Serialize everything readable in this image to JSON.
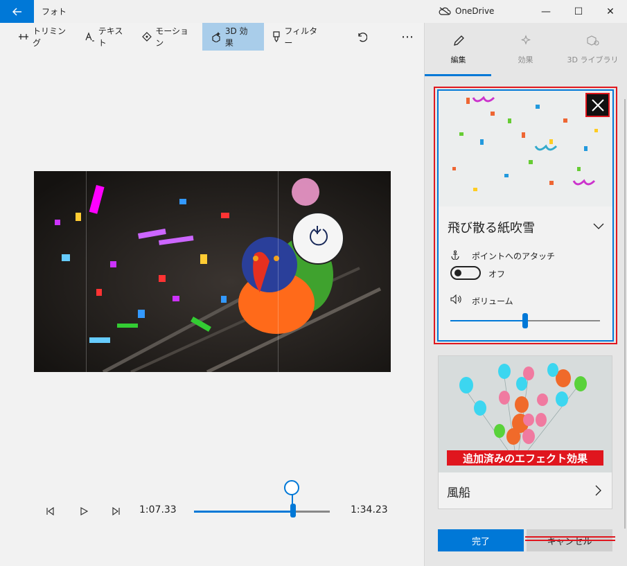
{
  "window": {
    "app_title": "フォト",
    "onedrive_label": "OneDrive",
    "minimize_glyph": "—",
    "maximize_glyph": "☐",
    "close_glyph": "✕"
  },
  "toolbar": {
    "trim_label": "トリミング",
    "text_label": "テキスト",
    "motion_label": "モーション",
    "effects3d_label": "3D 効果",
    "filter_label": "フィルター",
    "more_glyph": "⋯"
  },
  "playback": {
    "current_time": "1:07.33",
    "total_time": "1:34.23",
    "progress_fraction": 0.73
  },
  "tabs": {
    "edit": "編集",
    "effects": "効果",
    "library": "3D ライブラリ"
  },
  "effect_card": {
    "title": "飛び散る紙吹雪",
    "attach_label": "ポイントへのアタッチ",
    "toggle_state": "オフ",
    "volume_label": "ボリューム",
    "volume_fraction": 0.5
  },
  "balloon_card": {
    "added_label": "追加済みのエフェクト効果",
    "name": "風船"
  },
  "buttons": {
    "done": "完了",
    "cancel": "キャンセル"
  },
  "colors": {
    "accent": "#0078d7",
    "annotation_red": "#e0161e"
  }
}
